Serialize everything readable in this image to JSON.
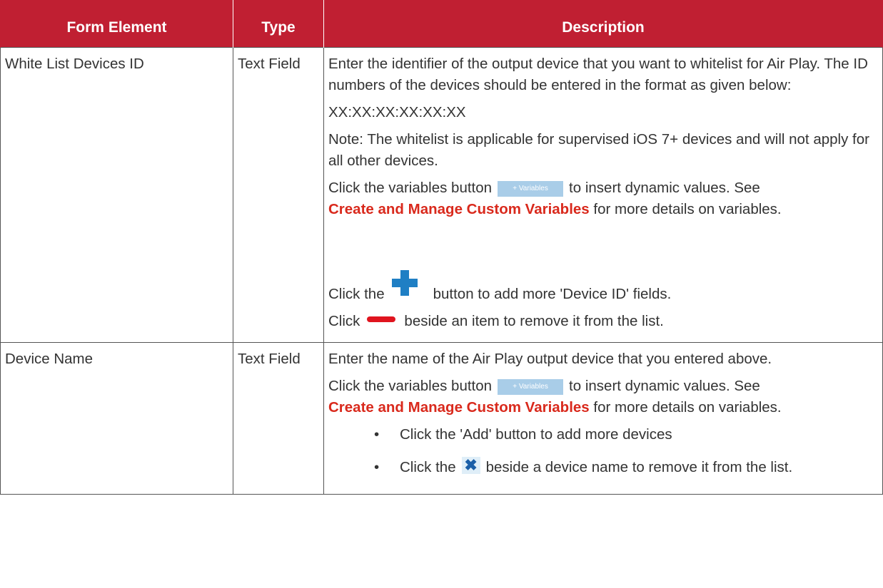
{
  "table": {
    "headers": [
      "Form Element",
      "Type",
      "Description"
    ],
    "rows": [
      {
        "element": "White List Devices ID",
        "type": "Text Field",
        "desc": {
          "p1": "Enter the identifier of the output device that you want to whitelist for Air Play. The ID numbers of the devices should be entered in the format as given below:",
          "format": "XX:XX:XX:XX:XX:XX",
          "note": "Note: The whitelist is applicable for supervised iOS 7+ devices and will not apply for all other devices.",
          "vars_before": "Click the variables button",
          "vars_btn": "+ Variables",
          "vars_after": "to insert dynamic values. See",
          "link": "Create and Manage Custom Variables",
          "link_after": "for more details on variables.",
          "add_before": "Click the",
          "add_after": "button to add more 'Device ID' fields.",
          "remove_before": "Click",
          "remove_after": "beside an item to remove it from the list."
        }
      },
      {
        "element": "Device Name",
        "type": "Text Field",
        "desc": {
          "p1": "Enter the name of the Air Play output device that you entered above.",
          "vars_before": "Click the variables button",
          "vars_btn": "+ Variables",
          "vars_after": "to insert dynamic values. See",
          "link": "Create and Manage Custom Variables",
          "link_after": "for more details on variables.",
          "bullets": [
            {
              "before": "Click the 'Add' button to add more devices",
              "after": ""
            },
            {
              "before": "Click the",
              "after": "beside a device name to remove it from the list."
            }
          ],
          "bullet_char": "•",
          "x_icon": "✖"
        }
      }
    ]
  }
}
